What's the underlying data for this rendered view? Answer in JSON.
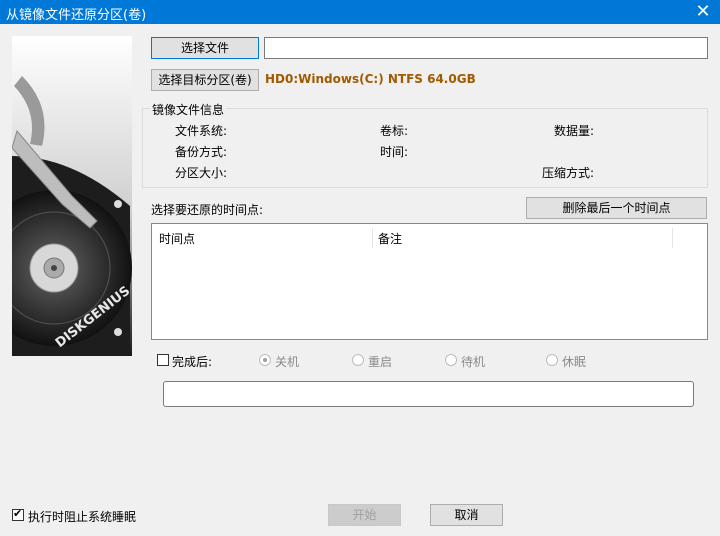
{
  "window": {
    "title": "从镜像文件还原分区(卷)",
    "close_icon": "✕"
  },
  "side_image": {
    "brand_text": "DISKGENIUS"
  },
  "select_file": {
    "button_label": "选择文件",
    "path_value": ""
  },
  "select_target": {
    "button_label": "选择目标分区(卷)",
    "target_value": "HD0:Windows(C:) NTFS 64.0GB"
  },
  "image_info": {
    "group_title": "镜像文件信息",
    "file_system_label": "文件系统:",
    "volume_label": "卷标:",
    "data_size_label": "数据量:",
    "backup_mode_label": "备份方式:",
    "time_label": "时间:",
    "partition_size_label": "分区大小:",
    "compression_label": "压缩方式:"
  },
  "timepoints": {
    "heading": "选择要还原的时间点:",
    "delete_button_label": "删除最后一个时间点",
    "columns": [
      "时间点",
      "备注"
    ],
    "rows": []
  },
  "after_completion": {
    "checkbox_label": "完成后:",
    "checked": false,
    "options": [
      "关机",
      "重启",
      "待机",
      "休眠"
    ],
    "selected": "关机"
  },
  "progress": {
    "value": 0
  },
  "footer": {
    "prevent_sleep_label": "执行时阻止系统睡眠",
    "prevent_sleep_checked": true,
    "start_button_label": "开始",
    "cancel_button_label": "取消"
  },
  "colors": {
    "titlebar": "#0078d7",
    "target_text": "#a05a00",
    "window_bg": "#f0f0f0"
  }
}
